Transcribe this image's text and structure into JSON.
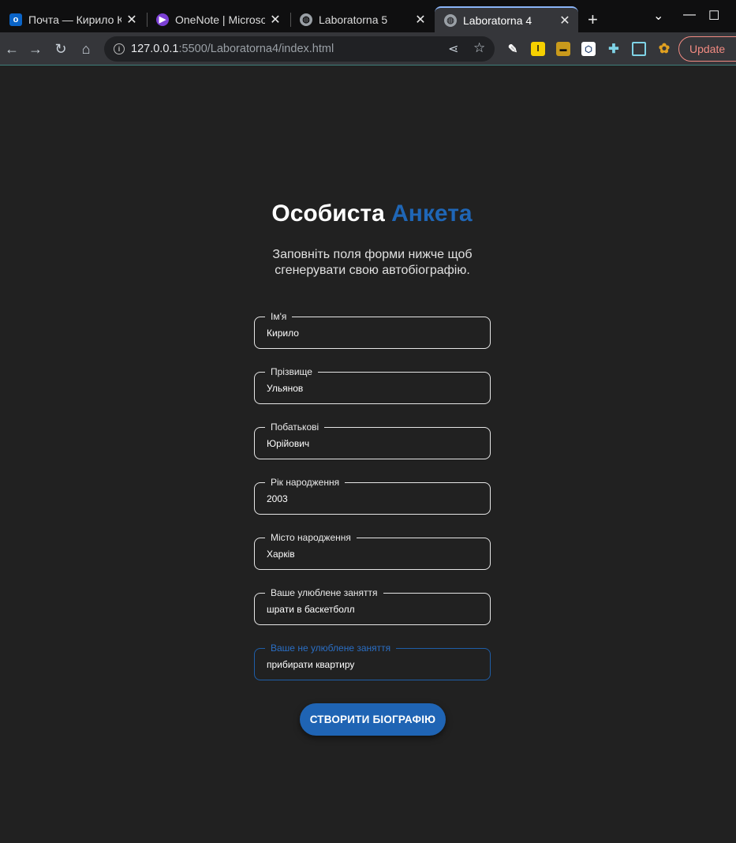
{
  "browser": {
    "tabs": [
      {
        "label": "Почта — Кирило К",
        "icon": "outlook-icon"
      },
      {
        "label": "OneNote | Microso",
        "icon": "onenote-icon"
      },
      {
        "label": "Laboratorna 5",
        "icon": "globe-icon"
      },
      {
        "label": "Laboratorna 4",
        "icon": "globe-icon",
        "active": true
      }
    ],
    "url_host": "127.0.0.1",
    "url_path": ":5500/Laboratorna4/index.html",
    "update_label": "Update"
  },
  "page": {
    "title_main": "Особиста",
    "title_accent": "Анкета",
    "subtitle": "Заповніть поля форми нижче щоб сгенерувати свою автобіографію.",
    "fields": [
      {
        "label": "Ім'я",
        "value": "Кирило"
      },
      {
        "label": "Прізвище",
        "value": "Ульянов"
      },
      {
        "label": "Побатькові",
        "value": "Юрійович"
      },
      {
        "label": "Рік народження",
        "value": "2003"
      },
      {
        "label": "Місто народження",
        "value": "Харків"
      },
      {
        "label": "Ваше улюблене заняття",
        "value": "шрати в баскетболл"
      },
      {
        "label": "Ваше не улюблене заняття",
        "value": "прибирати квартиру",
        "focused": true
      }
    ],
    "submit_label": "СТВОРИТИ БІОГРАФІЮ"
  },
  "colors": {
    "background": "#212121",
    "accent": "#1f66b6",
    "field_border": "#e6e6e6",
    "focused_border": "#1f5ea8"
  }
}
